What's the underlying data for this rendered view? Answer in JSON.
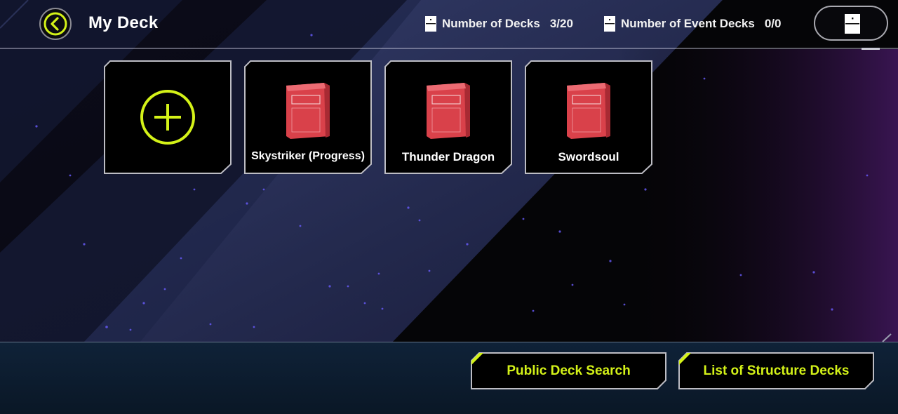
{
  "header": {
    "title": "My Deck",
    "stats": [
      {
        "label": "Number of Decks",
        "value": "3/20"
      },
      {
        "label": "Number of Event Decks",
        "value": "0/0"
      }
    ]
  },
  "decks": {
    "create_icon": "plus-circle-icon",
    "items": [
      {
        "name": "Skystriker (Progress)"
      },
      {
        "name": "Thunder Dragon"
      },
      {
        "name": "Swordsoul"
      }
    ]
  },
  "footer": {
    "public_search_label": "Public Deck Search",
    "structure_decks_label": "List of Structure Decks"
  },
  "colors": {
    "accent": "#d4f218",
    "deck_box": "#d9414a",
    "background": "#05050a",
    "panel_border": "#bdbdc4"
  },
  "icons": {
    "back": "chevron-left-icon",
    "deck": "deck-box-icon",
    "menu": "menu-icon",
    "stat": "card-icon"
  }
}
